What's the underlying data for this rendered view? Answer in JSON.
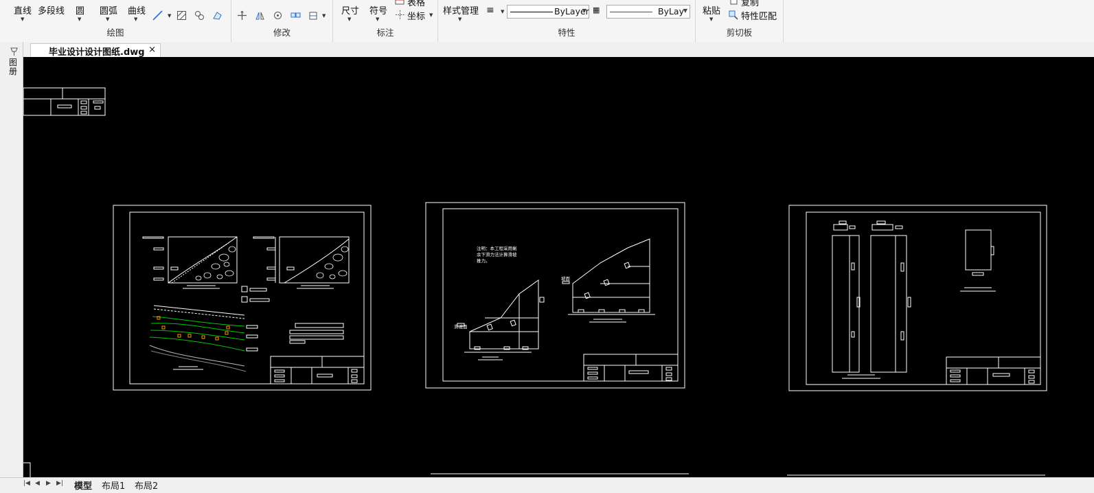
{
  "ribbon": {
    "draw": {
      "label": "绘图",
      "tools": {
        "line": "直线",
        "polyline": "多段线",
        "circle": "圆",
        "arc": "圆弧",
        "curve": "曲线"
      }
    },
    "modify": {
      "label": "修改"
    },
    "annotation": {
      "label": "标注",
      "tools": {
        "dimension": "尺寸",
        "symbol": "符号",
        "table": "表格",
        "coordinate": "坐标"
      }
    },
    "properties": {
      "label": "特性",
      "style_manager": "样式管理",
      "linetype_value": "ByLayer",
      "color_value": "ByLay"
    },
    "clipboard": {
      "label": "剪切板",
      "paste": "粘贴",
      "copy": "复制",
      "match_properties": "特性匹配"
    }
  },
  "document_tab": {
    "name": "毕业设计设计图纸.dwg",
    "close": "×"
  },
  "left_panel": {
    "label": "图册"
  },
  "layout_tabs": [
    "模型",
    "布局1",
    "布局2"
  ],
  "drawing": {
    "note": [
      "注明：本工程采用剩",
      "余下滑力法计算滑坡",
      "推力。"
    ],
    "slope_labels": [
      "滑坡面",
      "坡面"
    ]
  },
  "colors": {
    "canvas": "#000000",
    "line": "#ffffff",
    "contour": "#00c800",
    "marker": "#ff9900",
    "color_swatch": "#ff0000"
  }
}
